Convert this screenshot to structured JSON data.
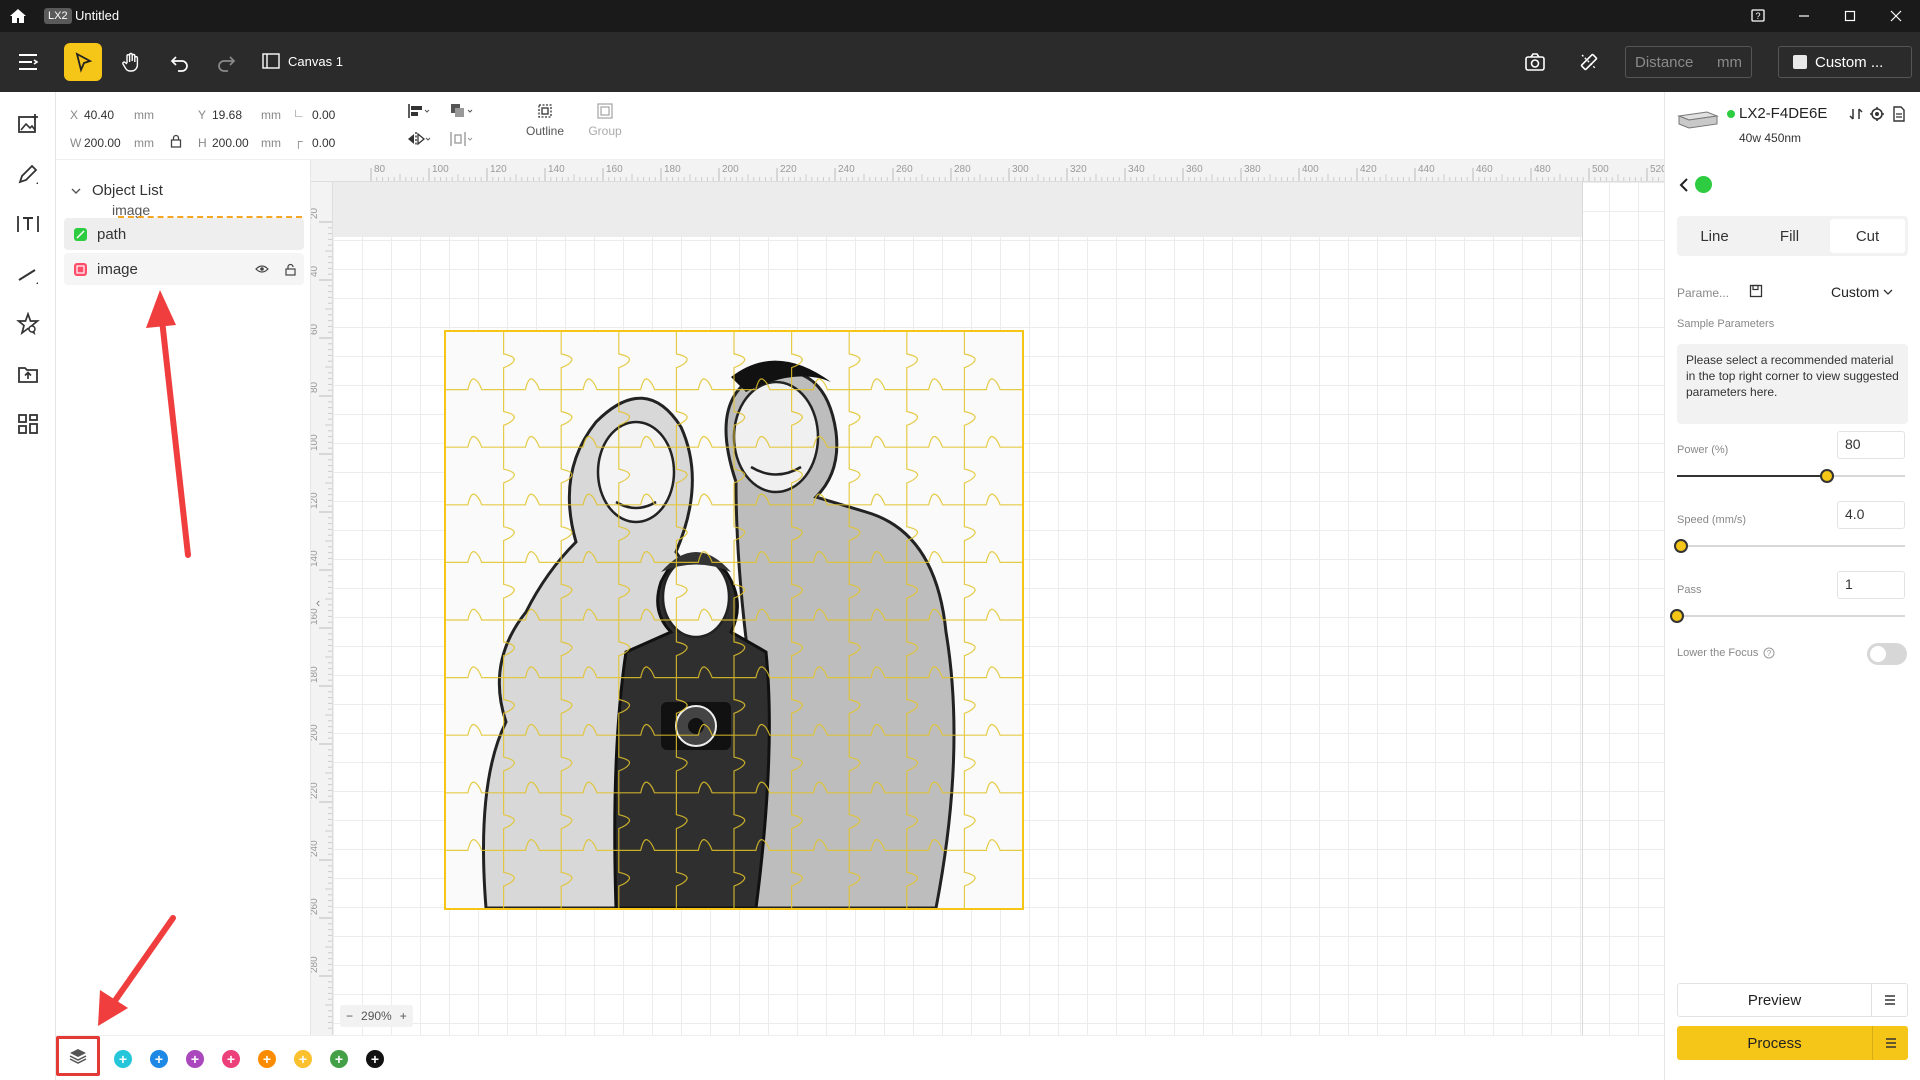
{
  "window": {
    "logo": "LX2",
    "title": "Untitled"
  },
  "toolbar": {
    "canvas_tab": "Canvas 1",
    "distance_placeholder": "Distance",
    "distance_unit": "mm",
    "device_preset": "Custom ..."
  },
  "props": {
    "x_label": "X",
    "x_value": "40.40",
    "x_unit": "mm",
    "y_label": "Y",
    "y_value": "19.68",
    "y_unit": "mm",
    "w_label": "W",
    "w_value": "200.00",
    "w_unit": "mm",
    "h_label": "H",
    "h_value": "200.00",
    "h_unit": "mm",
    "rotation_value": "0.00",
    "corner_value": "0.00",
    "outline_label": "Outline",
    "group_label": "Group"
  },
  "object_list": {
    "header": "Object List",
    "drag_ghost": "image",
    "items": [
      {
        "name": "path",
        "color": "#2ecc40"
      },
      {
        "name": "image",
        "color": "#ff4d6a"
      }
    ]
  },
  "ruler": {
    "h_ticks": [
      "80",
      "100",
      "120",
      "140",
      "160",
      "180",
      "200",
      "220",
      "240",
      "260",
      "280",
      "300",
      "320",
      "340",
      "360",
      "380",
      "400",
      "420",
      "440",
      "460",
      "480",
      "500",
      "520"
    ],
    "v_ticks": [
      "20",
      "40",
      "60",
      "80",
      "100",
      "120",
      "140",
      "160",
      "180",
      "200",
      "220",
      "240",
      "260",
      "280"
    ]
  },
  "canvas": {
    "zoom": "290%"
  },
  "layers": {
    "colors": [
      "#26c6da",
      "#1e88e5",
      "#ab47bc",
      "#ec407a",
      "#fb8c00",
      "#fbc02d",
      "#43a047",
      "#111111"
    ]
  },
  "device": {
    "name": "LX2-F4DE6E",
    "spec": "40w 450nm",
    "status_color": "#2ecc40"
  },
  "panel": {
    "tabs": [
      "Line",
      "Fill",
      "Cut"
    ],
    "selected_tab": "Cut",
    "params_label": "Parame...",
    "params_value": "Custom",
    "sample_label": "Sample Parameters",
    "note": "Please select a recommended material in the top right corner to view suggested parameters here.",
    "power_label": "Power  (%)",
    "power_value": "80",
    "power_level": 0.66,
    "speed_label": "Speed  (mm/s)",
    "speed_value": "4.0",
    "speed_level": 0.01,
    "pass_label": "Pass",
    "pass_value": "1",
    "pass_level": 0.0,
    "focus_label": "Lower the Focus",
    "focus_on": false,
    "preview_label": "Preview",
    "process_label": "Process"
  }
}
